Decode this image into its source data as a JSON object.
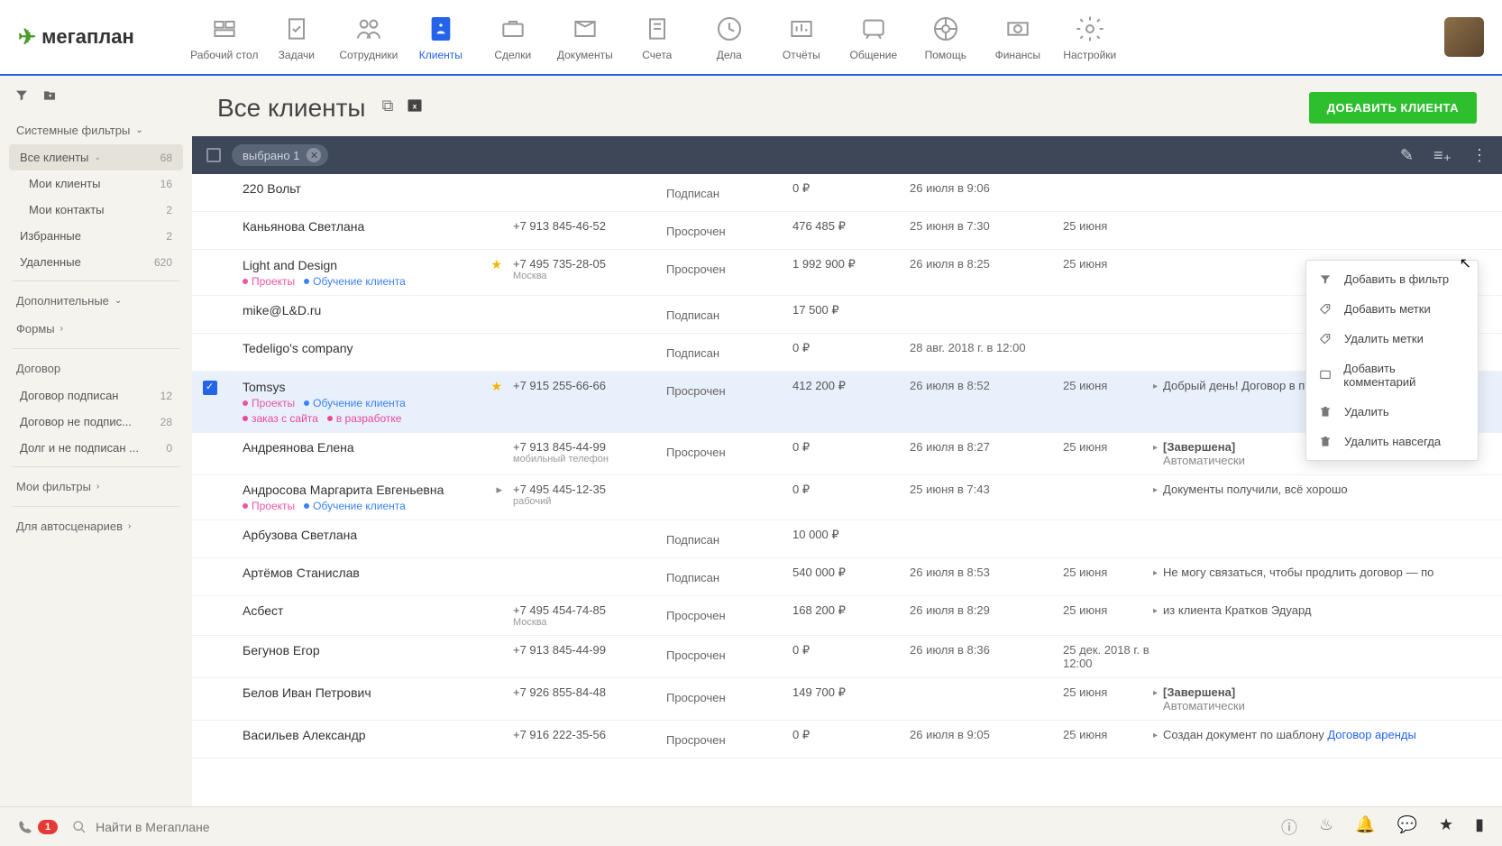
{
  "logo_text": "мегаплан",
  "nav": [
    {
      "label": "Рабочий стол"
    },
    {
      "label": "Задачи"
    },
    {
      "label": "Сотрудники"
    },
    {
      "label": "Клиенты",
      "active": true
    },
    {
      "label": "Сделки"
    },
    {
      "label": "Документы"
    },
    {
      "label": "Счета"
    },
    {
      "label": "Дела"
    },
    {
      "label": "Отчёты"
    },
    {
      "label": "Общение"
    },
    {
      "label": "Помощь"
    },
    {
      "label": "Финансы"
    },
    {
      "label": "Настройки"
    }
  ],
  "page_title": "Все клиенты",
  "add_button": "ДОБАВИТЬ КЛИЕНТА",
  "selected_chip": "выбрано 1",
  "sidebar": {
    "system_filters": "Системные фильтры",
    "items": [
      {
        "label": "Все клиенты",
        "count": "68",
        "active": true,
        "chev": true
      },
      {
        "label": "Мои клиенты",
        "count": "16",
        "indent": true
      },
      {
        "label": "Мои контакты",
        "count": "2",
        "indent": true
      },
      {
        "label": "Избранные",
        "count": "2"
      },
      {
        "label": "Удаленные",
        "count": "620"
      }
    ],
    "extra_title": "Дополнительные",
    "forms_title": "Формы",
    "contract_title": "Договор",
    "contract_items": [
      {
        "label": "Договор подписан",
        "count": "12"
      },
      {
        "label": "Договор не подпис...",
        "count": "28"
      },
      {
        "label": "Долг и не подписан ...",
        "count": "0"
      }
    ],
    "my_filters": "Мои фильтры",
    "auto_scripts": "Для автосценариев"
  },
  "context_menu": [
    "Добавить в фильтр",
    "Добавить метки",
    "Удалить метки",
    "Добавить комментарий",
    "Удалить",
    "Удалить навсегда"
  ],
  "rows": [
    {
      "name": "220 Вольт",
      "status": "Подписан",
      "amount": "0 ₽",
      "date1": "26 июля в 9:06"
    },
    {
      "name": "Каньянова Светлана",
      "phone": "+7 913 845-46-52",
      "status": "Просрочен",
      "amount": "476 485 ₽",
      "date1": "25 июня в 7:30",
      "date2": "25 июня"
    },
    {
      "name": "Light and Design",
      "star": true,
      "tags": [
        {
          "t": "Проекты",
          "c": "pink"
        },
        {
          "t": "Обучение клиента",
          "c": "blue"
        }
      ],
      "phone": "+7 495 735-28-05",
      "phone_sub": "Москва",
      "status": "Просрочен",
      "amount": "1 992 900 ₽",
      "date1": "26 июля в 8:25",
      "date2": "25 июня"
    },
    {
      "name": "mike@L&D.ru",
      "status": "Подписан",
      "amount": "17 500 ₽"
    },
    {
      "name": "Tedeligo's company",
      "status": "Подписан",
      "amount": "0 ₽",
      "date1": "28 авг. 2018 г. в 12:00"
    },
    {
      "name": "Tomsys",
      "selected": true,
      "star": true,
      "tags": [
        {
          "t": "Проекты",
          "c": "pink"
        },
        {
          "t": "Обучение клиента",
          "c": "blue"
        },
        {
          "t": "заказ с сайта",
          "c": "gpink"
        },
        {
          "t": "в разработке",
          "c": "gpink"
        }
      ],
      "phone": "+7 915 255-66-66",
      "status": "Просрочен",
      "amount": "412 200 ₽",
      "date1": "26 июля в 8:52",
      "date2": "25 июня",
      "note": "Добрый день! Договор в приложении, если"
    },
    {
      "name": "Андреянова Елена",
      "phone": "+7 913 845-44-99",
      "phone_sub": "мобильный телефон",
      "status": "Просрочен",
      "amount": "0 ₽",
      "date1": "26 июля в 8:27",
      "date2": "25 июня",
      "note_bold": "[Завершена]",
      "note_sub": "Автоматически"
    },
    {
      "name": "Андросова Маргарита Евгеньевна",
      "phone_caret": true,
      "tags": [
        {
          "t": "Проекты",
          "c": "pink"
        },
        {
          "t": "Обучение клиента",
          "c": "blue"
        }
      ],
      "phone": "+7 495 445-12-35",
      "phone_sub": "рабочий",
      "amount": "0 ₽",
      "date1": "25 июня в 7:43",
      "note": "Документы получили, всё хорошо"
    },
    {
      "name": "Арбузова Светлана",
      "status": "Подписан",
      "amount": "10 000 ₽"
    },
    {
      "name": "Артёмов Станислав",
      "status": "Подписан",
      "amount": "540 000 ₽",
      "date1": "26 июля в 8:53",
      "date2": "25 июня",
      "note": "Не могу связаться, чтобы продлить договор — по"
    },
    {
      "name": "Асбест",
      "phone": "+7 495 454-74-85",
      "phone_sub": "Москва",
      "status": "Просрочен",
      "amount": "168 200 ₽",
      "date1": "26 июля в 8:29",
      "date2": "25 июня",
      "note_plain": "из клиента Кратков Эдуард"
    },
    {
      "name": "Бегунов Егор",
      "phone": "+7 913 845-44-99",
      "status": "Просрочен",
      "amount": "0 ₽",
      "date1": "26 июля в 8:36",
      "date2": "25 дек. 2018 г. в 12:00"
    },
    {
      "name": "Белов Иван Петрович",
      "phone": "+7 926 855-84-48",
      "status": "Просрочен",
      "amount": "149 700 ₽",
      "date2": "25 июня",
      "note_bold": "[Завершена]",
      "note_sub": "Автоматически"
    },
    {
      "name": "Васильев Александр",
      "phone": "+7 916 222-35-56",
      "status": "Просрочен",
      "amount": "0 ₽",
      "date1": "26 июля в 9:05",
      "date2": "25 июня",
      "note": "Создан документ по шаблону",
      "note_link": "Договор аренды"
    }
  ],
  "search_placeholder": "Найти в Мегаплане",
  "phone_badge": "1"
}
